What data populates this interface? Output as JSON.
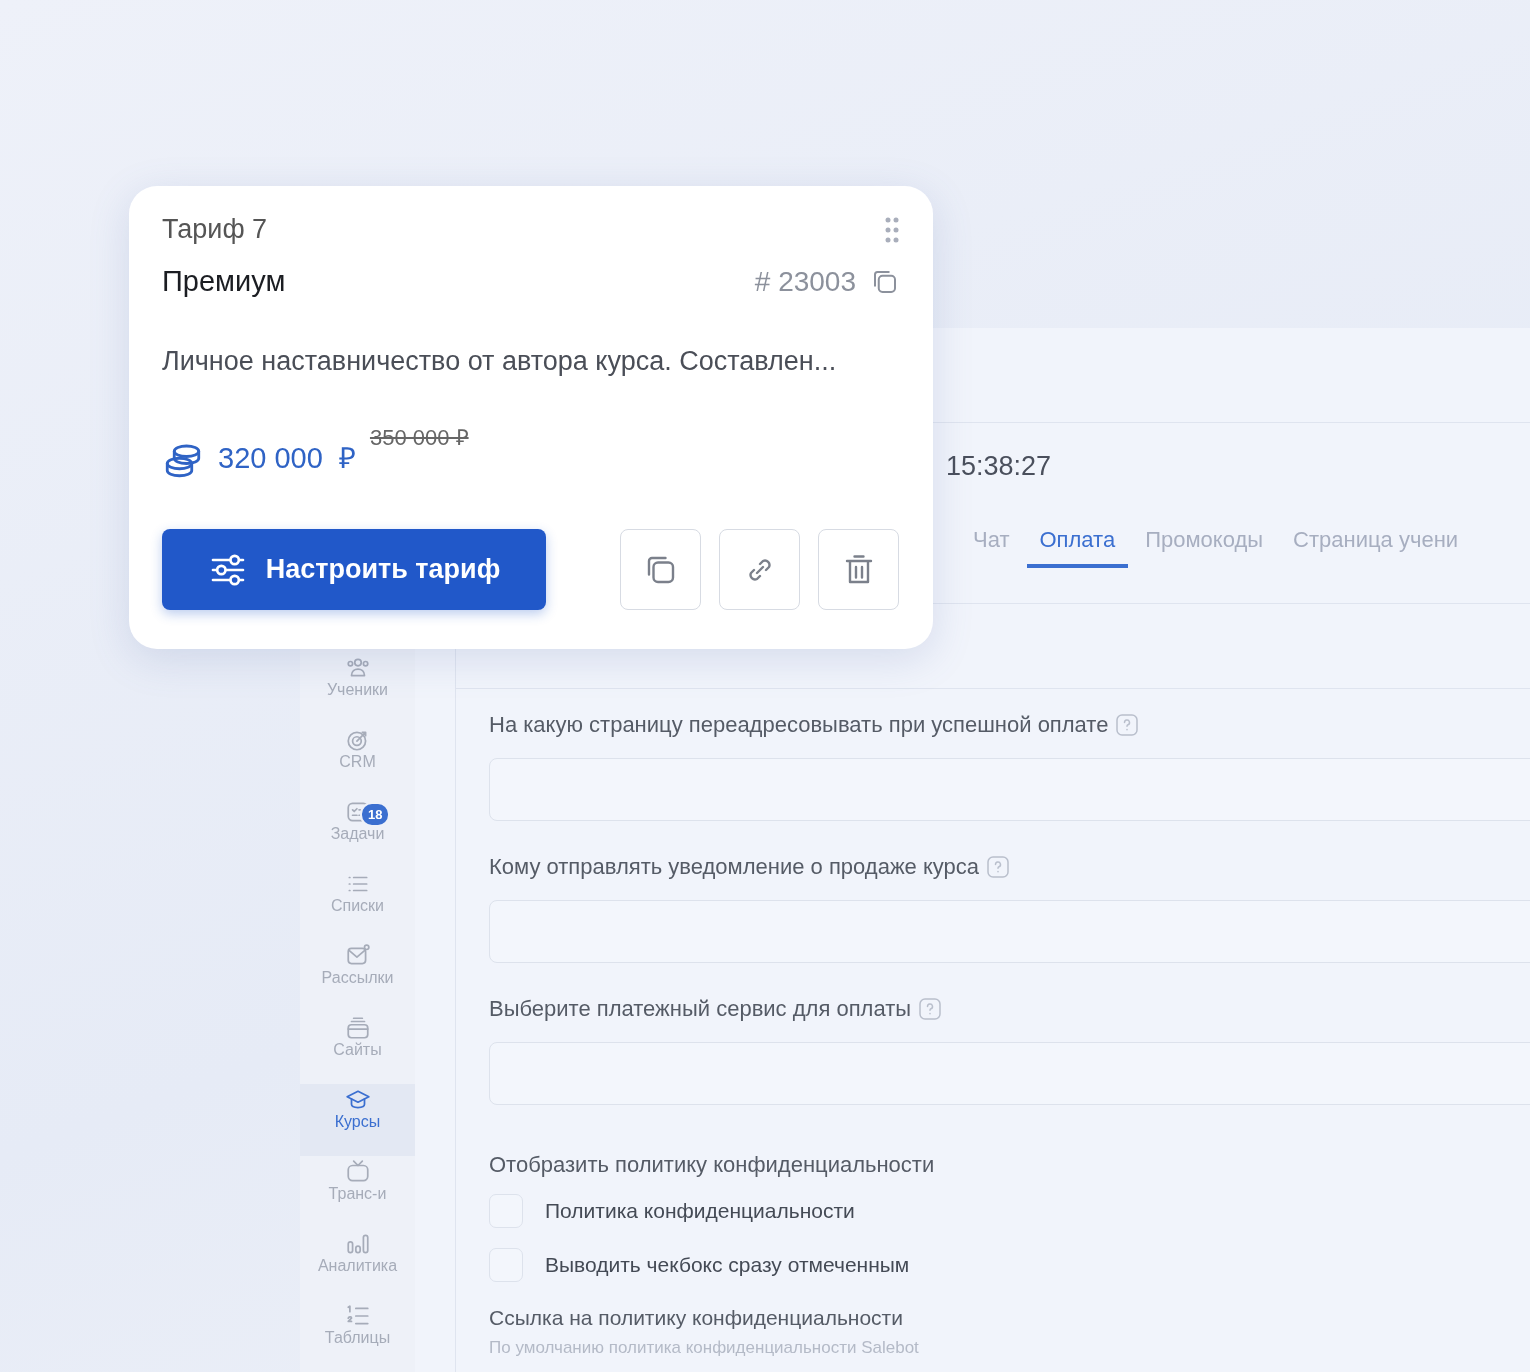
{
  "card": {
    "subtitle": "Тариф 7",
    "name": "Премиум",
    "id": "# 23003",
    "description": "Личное наставничество от автора курса. Составлен...",
    "price": "320 000  ₽",
    "old_price": "350 000 ₽",
    "primary_button": "Настроить тариф",
    "actions": [
      {
        "kind": "copy"
      },
      {
        "kind": "link"
      },
      {
        "kind": "delete"
      }
    ]
  },
  "header": {
    "time": "15:38:27"
  },
  "tabs": [
    {
      "label": "Чат",
      "selected": false
    },
    {
      "label": "Оплата",
      "selected": true
    },
    {
      "label": "Промокоды",
      "selected": false
    },
    {
      "label": "Страница учени",
      "selected": false
    }
  ],
  "sidebar": {
    "items": [
      {
        "label": "Ученики",
        "selected": false
      },
      {
        "label": "CRM",
        "selected": false
      },
      {
        "label": "Задачи",
        "selected": false,
        "badge": "18"
      },
      {
        "label": "Списки",
        "selected": false
      },
      {
        "label": "Рассылки",
        "selected": false
      },
      {
        "label": "Сайты",
        "selected": false
      },
      {
        "label": "Курсы",
        "selected": true
      },
      {
        "label": "Транс-и",
        "selected": false
      },
      {
        "label": "Аналитика",
        "selected": false
      },
      {
        "label": "Таблицы",
        "selected": false
      }
    ]
  },
  "form": {
    "fields": [
      {
        "label": "На какую страницу переадресовывать при успешной оплате",
        "help": true
      },
      {
        "label": "Кому отправлять уведомление о продаже курса",
        "help": true
      },
      {
        "label": "Выберите платежный сервис для оплаты",
        "help": true
      }
    ],
    "privacy_title": "Отобразить политику конфиденциальности",
    "checkboxes": [
      {
        "label": "Политика конфиденциальности",
        "checked": false
      },
      {
        "label": "Выводить чекбокс сразу отмеченным",
        "checked": false
      }
    ],
    "link_label": "Ссылка на политику конфиденциальности",
    "link_hint": "По умолчанию политика конфиденциальности Salebot"
  }
}
